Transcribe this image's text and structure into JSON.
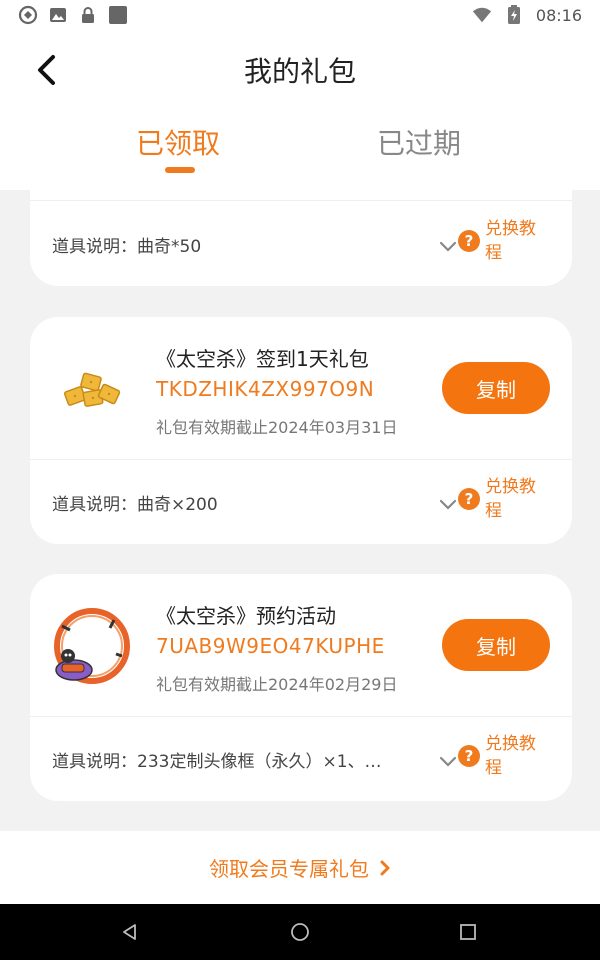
{
  "status_bar": {
    "time": "08:16",
    "icons": [
      "vpn-icon",
      "image-icon",
      "lock-icon",
      "square-icon",
      "wifi-icon",
      "battery-icon"
    ]
  },
  "header": {
    "title": "我的礼包",
    "tabs": [
      {
        "label": "已领取",
        "active": true
      },
      {
        "label": "已过期",
        "active": false
      }
    ]
  },
  "colors": {
    "accent": "#f07b1e",
    "button": "#f47410",
    "background": "#f2f2f2"
  },
  "gifts": [
    {
      "desc_label": "道具说明：",
      "desc_value": "曲奇*50",
      "help_label": "兑换教程"
    },
    {
      "name": "《太空杀》签到1天礼包",
      "code": "TKDZHIK4ZX997O9N",
      "expiry": "礼包有效期截止2024年03月31日",
      "copy_label": "复制",
      "desc_label": "道具说明：",
      "desc_value": "曲奇×200",
      "help_label": "兑换教程",
      "image": "cookies-icon"
    },
    {
      "name": "《太空杀》预约活动",
      "code": "7UAB9W9EO47KUPHE",
      "expiry": "礼包有效期截止2024年02月29日",
      "copy_label": "复制",
      "desc_label": "道具说明：",
      "desc_value": "233定制头像框（永久）×1、…",
      "help_label": "兑换教程",
      "image": "avatar-frame-icon"
    }
  ],
  "bottom": {
    "vip_link": "领取会员专属礼包"
  },
  "nav": [
    "back-nav-icon",
    "home-nav-icon",
    "recents-nav-icon"
  ]
}
